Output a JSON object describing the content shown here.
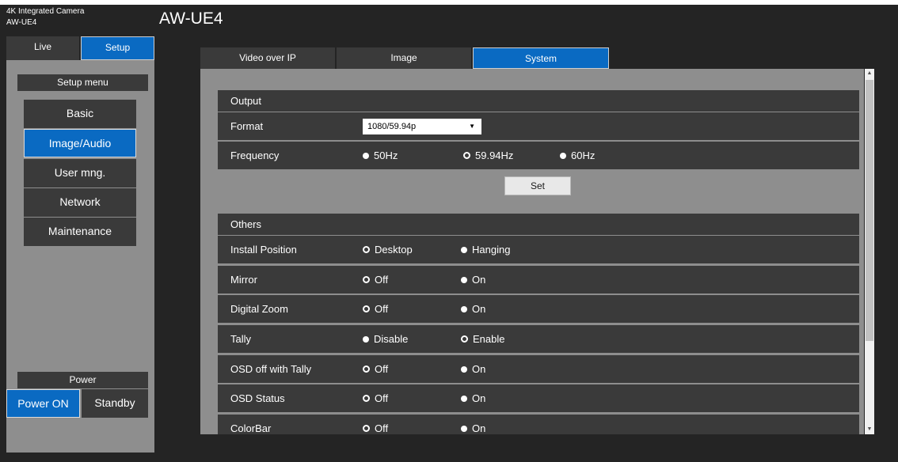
{
  "camera": {
    "type_line": "4K Integrated Camera",
    "model_line": "AW-UE4"
  },
  "title": "AW-UE4",
  "mode_tabs": [
    {
      "label": "Live"
    },
    {
      "label": "Setup"
    }
  ],
  "setup_menu": {
    "title": "Setup menu",
    "items": [
      {
        "label": "Basic"
      },
      {
        "label": "Image/Audio"
      },
      {
        "label": "User mng."
      },
      {
        "label": "Network"
      },
      {
        "label": "Maintenance"
      }
    ],
    "active": "Image/Audio"
  },
  "power": {
    "title": "Power",
    "on_label": "Power ON",
    "standby_label": "Standby"
  },
  "tabs": [
    {
      "label": "Video over IP"
    },
    {
      "label": "Image"
    },
    {
      "label": "System"
    }
  ],
  "active_tab": "System",
  "output": {
    "heading": "Output",
    "format": {
      "label": "Format",
      "value": "1080/59.94p"
    },
    "frequency": {
      "label": "Frequency",
      "options": [
        "50Hz",
        "59.94Hz",
        "60Hz"
      ],
      "selected": "59.94Hz"
    },
    "set_label": "Set"
  },
  "others": {
    "heading": "Others",
    "rows": [
      {
        "label": "Install Position",
        "options": [
          "Desktop",
          "Hanging"
        ],
        "selected": "Desktop"
      },
      {
        "label": "Mirror",
        "options": [
          "Off",
          "On"
        ],
        "selected": "Off"
      },
      {
        "label": "Digital Zoom",
        "options": [
          "Off",
          "On"
        ],
        "selected": "Off"
      },
      {
        "label": "Tally",
        "options": [
          "Disable",
          "Enable"
        ],
        "selected": "Enable"
      },
      {
        "label": "OSD off with Tally",
        "options": [
          "Off",
          "On"
        ],
        "selected": "Off"
      },
      {
        "label": "OSD Status",
        "options": [
          "Off",
          "On"
        ],
        "selected": "Off"
      },
      {
        "label": "ColorBar",
        "options": [
          "Off",
          "On"
        ],
        "selected": "Off"
      }
    ]
  },
  "colors": {
    "accent": "#0a6ac2",
    "panel_dark": "#3a3a3a",
    "panel_gray": "#8e8e8e",
    "background": "#242424"
  }
}
